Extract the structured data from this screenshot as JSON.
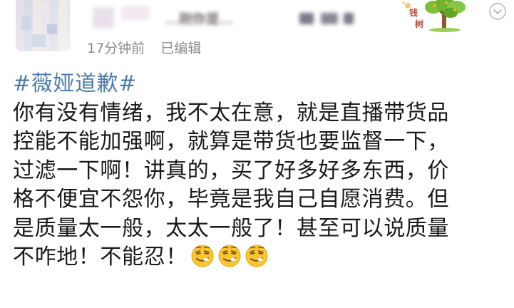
{
  "header": {
    "username": "…刚你是… ",
    "time_ago": "17分钟前",
    "edited_label": "已编辑",
    "badge_text": "钱树"
  },
  "post": {
    "hashtag": "#薇娅道歉#",
    "lines": [
      "你有没有情绪，我不太在意，就是直播带货品",
      "控能不能加强啊，就算是带货也要监督一下，",
      "过滤一下啊！讲真的，买了好多好多东西，价",
      "格不便宜不怨你，毕竟是我自己自愿消费。但",
      "是质量太一般，太太一般了！甚至可以说质量",
      "不咋地！不能忍！"
    ],
    "emoji": [
      "smirk-emoji",
      "smirk-emoji",
      "smirk-emoji"
    ]
  },
  "colors": {
    "hashtag": "#4d7bab",
    "text": "#1a1a1a",
    "meta": "#8b8b8b",
    "emoji_face": "#f7c631"
  }
}
